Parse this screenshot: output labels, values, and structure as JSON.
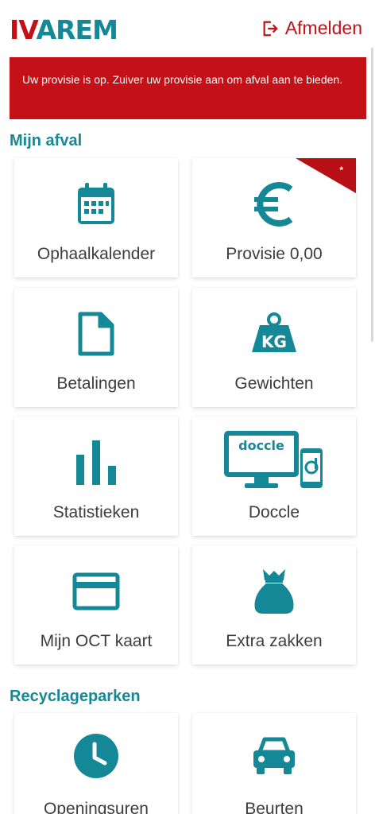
{
  "brand": {
    "logo_i": "I",
    "logo_v": "V",
    "logo_rest": "AREM",
    "primary_color": "#148896",
    "accent_color": "#c41017"
  },
  "header": {
    "logout_label": "Afmelden"
  },
  "alert": {
    "text": "Uw provisie is op. Zuiver uw provisie aan om afval aan te bieden."
  },
  "sections": {
    "mijn_afval": {
      "title": "Mijn afval",
      "tiles": [
        {
          "label": "Ophaalkalender",
          "icon": "calendar-icon"
        },
        {
          "label": "Provisie 0,00",
          "icon": "euro-icon",
          "badge": "*"
        },
        {
          "label": "Betalingen",
          "icon": "document-icon"
        },
        {
          "label": "Gewichten",
          "icon": "weight-kg-icon"
        },
        {
          "label": "Statistieken",
          "icon": "bar-chart-icon"
        },
        {
          "label": "Doccle",
          "icon": "doccle-icon",
          "icon_text": "doccle"
        },
        {
          "label": "Mijn OCT kaart",
          "icon": "credit-card-icon"
        },
        {
          "label": "Extra zakken",
          "icon": "bag-icon"
        }
      ]
    },
    "recyclageparken": {
      "title": "Recyclageparken",
      "tiles": [
        {
          "label": "Openingsuren",
          "icon": "clock-icon"
        },
        {
          "label": "Beurten",
          "icon": "car-icon"
        }
      ]
    }
  }
}
